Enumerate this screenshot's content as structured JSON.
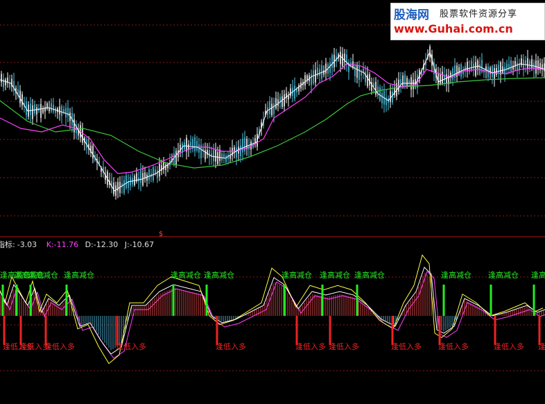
{
  "indicator": {
    "label": "指标:",
    "value": "-3.03",
    "k_label": "K:",
    "k_value": "-11.76",
    "d_label": "D:",
    "d_value": "-12.30",
    "j_label": "J:",
    "j_value": "-10.67"
  },
  "watermark": {
    "brand": "股海网",
    "tagline": "股票软件资源分享",
    "url": "www.Guhai.com.cn"
  },
  "colors": {
    "background": "#000000",
    "up_candle": "#ffffff",
    "ma_short": "#ffffff",
    "ma_mid": "#ff40ff",
    "ma_long": "#3cc83c",
    "sell_signal": "#22ee22",
    "buy_signal": "#ee2222",
    "grid": "#8a1a1a",
    "hist_pos": "#d04040",
    "hist_neg": "#4aa0c0"
  },
  "chart_data": [
    {
      "type": "candlestick",
      "title": "",
      "grid": true,
      "series": [
        {
          "name": "",
          "role": "short-ma",
          "color": "#ffffff"
        },
        {
          "name": "",
          "role": "mid-ma",
          "color": "#ff40ff"
        },
        {
          "name": "",
          "role": "long-ma",
          "color": "#3cc83c"
        }
      ],
      "price_range": [
        0,
        100
      ],
      "path": [
        [
          0,
          115
        ],
        [
          16,
          120
        ],
        [
          40,
          160
        ],
        [
          70,
          155
        ],
        [
          100,
          165
        ],
        [
          120,
          200
        ],
        [
          145,
          240
        ],
        [
          165,
          275
        ],
        [
          185,
          262
        ],
        [
          205,
          258
        ],
        [
          225,
          250
        ],
        [
          245,
          235
        ],
        [
          265,
          210
        ],
        [
          285,
          212
        ],
        [
          305,
          225
        ],
        [
          325,
          228
        ],
        [
          345,
          215
        ],
        [
          370,
          205
        ],
        [
          385,
          160
        ],
        [
          400,
          150
        ],
        [
          425,
          130
        ],
        [
          450,
          110
        ],
        [
          470,
          102
        ],
        [
          490,
          80
        ],
        [
          505,
          95
        ],
        [
          525,
          105
        ],
        [
          545,
          135
        ],
        [
          560,
          145
        ],
        [
          580,
          120
        ],
        [
          600,
          120
        ],
        [
          620,
          75
        ],
        [
          632,
          118
        ],
        [
          650,
          110
        ],
        [
          670,
          100
        ],
        [
          690,
          95
        ],
        [
          710,
          105
        ],
        [
          730,
          100
        ],
        [
          750,
          92
        ],
        [
          770,
          95
        ],
        [
          786,
          100
        ]
      ],
      "ma_mid_path": [
        [
          0,
          170
        ],
        [
          30,
          185
        ],
        [
          60,
          190
        ],
        [
          90,
          180
        ],
        [
          110,
          185
        ],
        [
          130,
          200
        ],
        [
          150,
          230
        ],
        [
          170,
          250
        ],
        [
          190,
          248
        ],
        [
          215,
          240
        ],
        [
          240,
          230
        ],
        [
          260,
          220
        ],
        [
          280,
          212
        ],
        [
          300,
          212
        ],
        [
          320,
          218
        ],
        [
          340,
          218
        ],
        [
          360,
          212
        ],
        [
          380,
          200
        ],
        [
          395,
          170
        ],
        [
          410,
          160
        ],
        [
          440,
          140
        ],
        [
          460,
          120
        ],
        [
          480,
          110
        ],
        [
          500,
          92
        ],
        [
          520,
          95
        ],
        [
          540,
          105
        ],
        [
          560,
          120
        ],
        [
          580,
          125
        ],
        [
          600,
          122
        ],
        [
          615,
          100
        ],
        [
          630,
          105
        ],
        [
          650,
          112
        ],
        [
          670,
          102
        ],
        [
          690,
          100
        ],
        [
          710,
          105
        ],
        [
          730,
          106
        ],
        [
          750,
          100
        ],
        [
          770,
          98
        ],
        [
          786,
          100
        ]
      ],
      "ma_long_path": [
        [
          0,
          145
        ],
        [
          40,
          175
        ],
        [
          80,
          190
        ],
        [
          120,
          185
        ],
        [
          160,
          195
        ],
        [
          200,
          218
        ],
        [
          240,
          235
        ],
        [
          280,
          242
        ],
        [
          320,
          238
        ],
        [
          360,
          226
        ],
        [
          400,
          210
        ],
        [
          440,
          190
        ],
        [
          470,
          172
        ],
        [
          500,
          150
        ],
        [
          520,
          138
        ],
        [
          550,
          130
        ],
        [
          580,
          125
        ],
        [
          620,
          123
        ],
        [
          660,
          118
        ],
        [
          700,
          115
        ],
        [
          740,
          113
        ],
        [
          786,
          112
        ]
      ]
    },
    {
      "type": "line",
      "title": "",
      "grid": true,
      "series": [
        {
          "name": "K",
          "color": "#ffffff",
          "last": -11.76
        },
        {
          "name": "D",
          "color": "#ff40ff",
          "last": -12.3
        },
        {
          "name": "J",
          "color": "#ffff40",
          "last": -10.67
        }
      ],
      "oscillator_path": [
        [
          0,
          420
        ],
        [
          10,
          440
        ],
        [
          20,
          410
        ],
        [
          30,
          425
        ],
        [
          40,
          440
        ],
        [
          50,
          415
        ],
        [
          60,
          450
        ],
        [
          70,
          430
        ],
        [
          85,
          440
        ],
        [
          100,
          425
        ],
        [
          115,
          470
        ],
        [
          130,
          465
        ],
        [
          145,
          490
        ],
        [
          160,
          510
        ],
        [
          175,
          500
        ],
        [
          190,
          440
        ],
        [
          210,
          440
        ],
        [
          230,
          420
        ],
        [
          250,
          410
        ],
        [
          270,
          415
        ],
        [
          290,
          420
        ],
        [
          305,
          455
        ],
        [
          320,
          465
        ],
        [
          340,
          460
        ],
        [
          360,
          450
        ],
        [
          380,
          440
        ],
        [
          395,
          400
        ],
        [
          410,
          410
        ],
        [
          430,
          445
        ],
        [
          450,
          420
        ],
        [
          470,
          425
        ],
        [
          490,
          420
        ],
        [
          510,
          425
        ],
        [
          530,
          440
        ],
        [
          550,
          460
        ],
        [
          570,
          470
        ],
        [
          585,
          440
        ],
        [
          600,
          420
        ],
        [
          612,
          385
        ],
        [
          622,
          395
        ],
        [
          630,
          475
        ],
        [
          640,
          480
        ],
        [
          655,
          470
        ],
        [
          670,
          430
        ],
        [
          690,
          440
        ],
        [
          710,
          455
        ],
        [
          730,
          450
        ],
        [
          745,
          445
        ],
        [
          760,
          440
        ],
        [
          775,
          450
        ],
        [
          786,
          446
        ]
      ],
      "histogram_zero": 455,
      "sell_signals": {
        "label": "逢高减仓",
        "x": [
          4,
          24,
          44,
          96,
          250,
          298,
          410,
          465,
          515,
          640,
          708,
          770
        ]
      },
      "buy_signals": {
        "label": "逢低入多",
        "x": [
          6,
          30,
          66,
          169,
          313,
          428,
          476,
          566,
          634,
          714,
          778
        ]
      }
    }
  ]
}
